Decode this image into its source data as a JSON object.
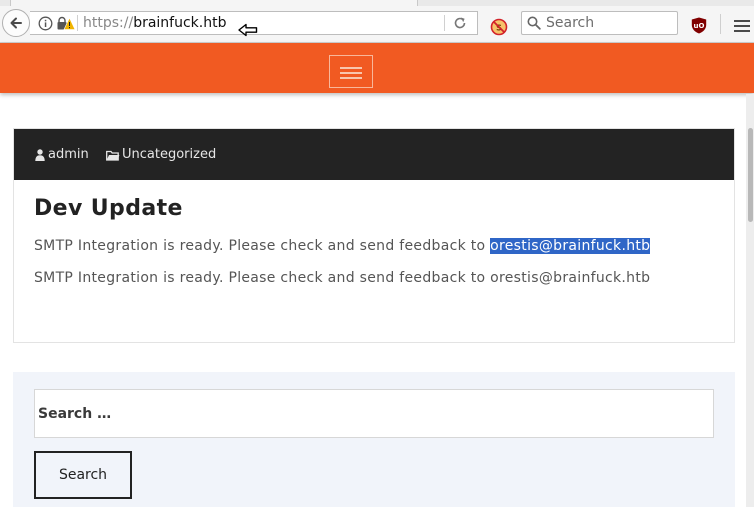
{
  "browser": {
    "url_scheme": "https://",
    "url_host": "brainfuck.htb",
    "search_placeholder": "Search",
    "icons": {
      "back": "back-arrow-icon",
      "info": "info-icon",
      "lock": "insecure-lock-icon",
      "reload": "reload-icon",
      "noscript": "noscript-icon",
      "search": "magnifier-icon",
      "ublock": "ublock-icon",
      "menu": "hamburger-menu-icon",
      "cursor": "mouse-cursor-icon"
    }
  },
  "site": {
    "header_color": "#f15a22"
  },
  "post": {
    "author": "admin",
    "category": "Uncategorized",
    "title": "Dev Update",
    "line_prefix": "SMTP Integration is ready. Please check and send feedback to ",
    "email": "orestis@brainfuck.htb",
    "line2": "SMTP Integration is ready. Please check and send feedback to orestis@brainfuck.htb"
  },
  "search_widget": {
    "placeholder": "Search …",
    "button_label": "Search"
  }
}
